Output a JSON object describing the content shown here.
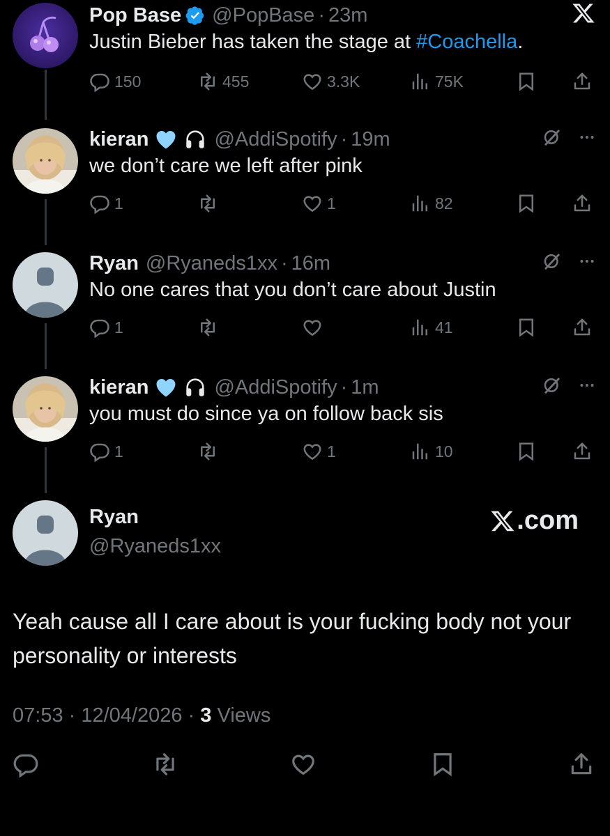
{
  "thread": [
    {
      "name": "Pop Base",
      "verified": true,
      "handle": "@PopBase",
      "time": "23m",
      "text_plain": "Justin Bieber has taken the stage at ",
      "hashtag": "#Coachella",
      "text_after": ".",
      "replies": "150",
      "reposts": "455",
      "likes": "3.3K",
      "views": "75K"
    },
    {
      "name": "kieran",
      "handle": "@AddiSpotify",
      "time": "19m",
      "text": "we don’t care we left after pink",
      "replies": "1",
      "reposts": "",
      "likes": "1",
      "views": "82"
    },
    {
      "name": "Ryan",
      "handle": "@Ryaneds1xx",
      "time": "16m",
      "text": "No one cares that you don’t care about Justin",
      "replies": "1",
      "reposts": "",
      "likes": "",
      "views": "41"
    },
    {
      "name": "kieran",
      "handle": "@AddiSpotify",
      "time": "1m",
      "text": "you must do since ya on follow back sis",
      "replies": "1",
      "reposts": "",
      "likes": "1",
      "views": "10"
    }
  ],
  "main_post": {
    "name": "Ryan",
    "handle": "@Ryaneds1xx",
    "brand": ".com",
    "text": "Yeah cause all I care about is your fucking body not your personality or interests",
    "time": "07:53",
    "date": "12/04/2026",
    "views_count": "3",
    "views_label": "Views"
  },
  "colors": {
    "background": "#000000",
    "text": "#e7e9ea",
    "muted": "#71767b",
    "link": "#1d9bf0",
    "verified": "#1d9bf0",
    "heart_emoji": "#8fd3ff"
  },
  "icons": [
    "x-logo-icon",
    "verified-badge-icon",
    "reply-icon",
    "repost-icon",
    "like-icon",
    "views-icon",
    "bookmark-icon",
    "share-icon",
    "grok-icon",
    "more-icon",
    "light-blue-heart-icon",
    "headphones-icon"
  ]
}
